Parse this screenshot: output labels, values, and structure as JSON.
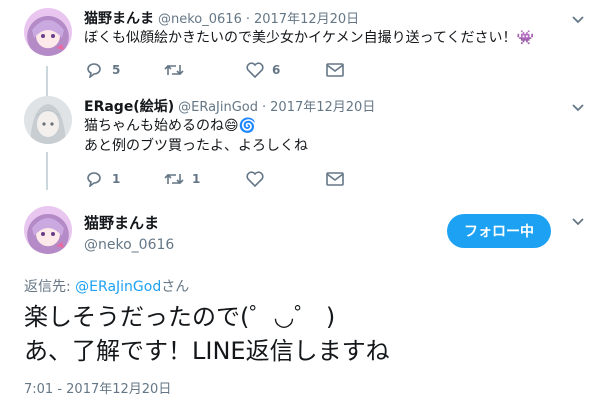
{
  "tweet1": {
    "name": "猫野まんま",
    "handle": "@neko_0616",
    "sep": "·",
    "date": "2017年12月20日",
    "text": "ぼくも似顔絵かきたいので美少女かイケメン自撮り送ってください！",
    "emoji": "👾",
    "reply_count": "5",
    "retweet_count": "",
    "like_count": "6"
  },
  "tweet2": {
    "name": "ERage(絵垢)",
    "handle": "@ERaJinGod",
    "sep": "·",
    "date": "2017年12月20日",
    "line1": "猫ちゃんも始めるのね",
    "line1_emoji": "😄🌀",
    "line2": "あと例のブツ買ったよ、よろしくね",
    "reply_count": "1",
    "retweet_count": "1",
    "like_count": ""
  },
  "main": {
    "name": "猫野まんま",
    "handle": "@neko_0616",
    "follow_label": "フォロー中",
    "replying_prefix": "返信先: ",
    "replying_to": "@ERaJinGod",
    "replying_suffix": "さん",
    "line1": "楽しそうだったので(゜◡゜ )",
    "line2": "あ、了解です！LINE返信しますね",
    "timestamp": "7:01 - 2017年12月20日"
  },
  "colors": {
    "accent": "#1da1f2",
    "muted": "#657786",
    "thread": "#ccd6dd"
  }
}
